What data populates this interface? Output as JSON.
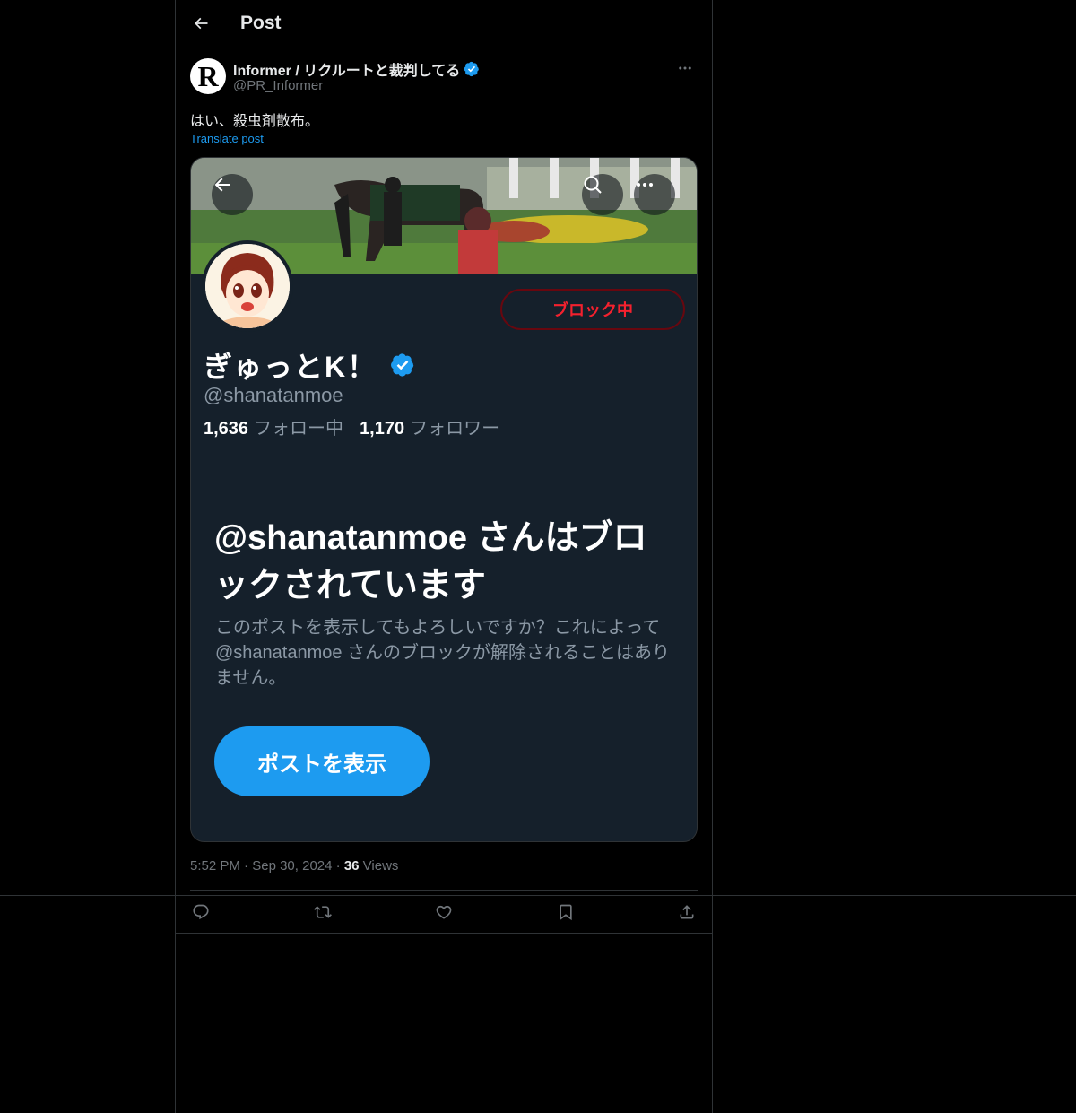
{
  "header": {
    "title": "Post"
  },
  "post": {
    "author_name": "Informer / リクルートと裁判してる",
    "author_handle": "@PR_Informer",
    "avatar_letter": "R",
    "text": "はい、殺虫剤散布。",
    "translate_label": "Translate post",
    "time": "5:52 PM",
    "date": "Sep 30, 2024",
    "views_count": "36",
    "views_label": "Views"
  },
  "screenshot": {
    "blocked_button": "ブロック中",
    "profile_name": "ぎゅっとK！",
    "profile_handle": "@shanatanmoe",
    "following_count": "1,636",
    "following_label": "フォロー中",
    "followers_count": "1,170",
    "followers_label": "フォロワー",
    "blocked_title": "@shanatanmoe さんはブロックされています",
    "blocked_desc": "このポストを表示してもよろしいですか？これによって@shanatanmoe さんのブロックが解除されることはありません。",
    "view_post_button": "ポストを表示"
  },
  "colors": {
    "accent": "#1d9bf0",
    "blocked_red": "#f4212e",
    "background": "#000000",
    "screenshot_bg": "#15202b"
  },
  "icons": [
    "back-arrow-icon",
    "verified-badge-icon",
    "more-icon",
    "search-icon",
    "reply-icon",
    "repost-icon",
    "like-icon",
    "bookmark-icon",
    "share-icon"
  ]
}
